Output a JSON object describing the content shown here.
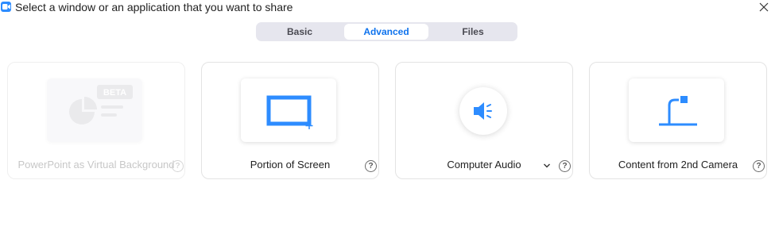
{
  "window": {
    "title": "Select a window or an application that you want to share"
  },
  "tabs": [
    {
      "label": "Basic",
      "selected": false
    },
    {
      "label": "Advanced",
      "selected": true
    },
    {
      "label": "Files",
      "selected": false
    }
  ],
  "cards": [
    {
      "label": "PowerPoint as Virtual Background",
      "badge": "BETA",
      "icon": "powerpoint-icon",
      "enabled": false
    },
    {
      "label": "Portion of Screen",
      "icon": "portion-screen-icon",
      "enabled": true
    },
    {
      "label": "Computer Audio",
      "icon": "speaker-icon",
      "enabled": true,
      "has_dropdown": true
    },
    {
      "label": "Content from 2nd Camera",
      "icon": "document-camera-icon",
      "enabled": true
    }
  ],
  "help_symbol": "?",
  "colors": {
    "accent": "#0e72ed",
    "icon_blue": "#2d8cff",
    "tab_bg": "#e6e6ee"
  }
}
